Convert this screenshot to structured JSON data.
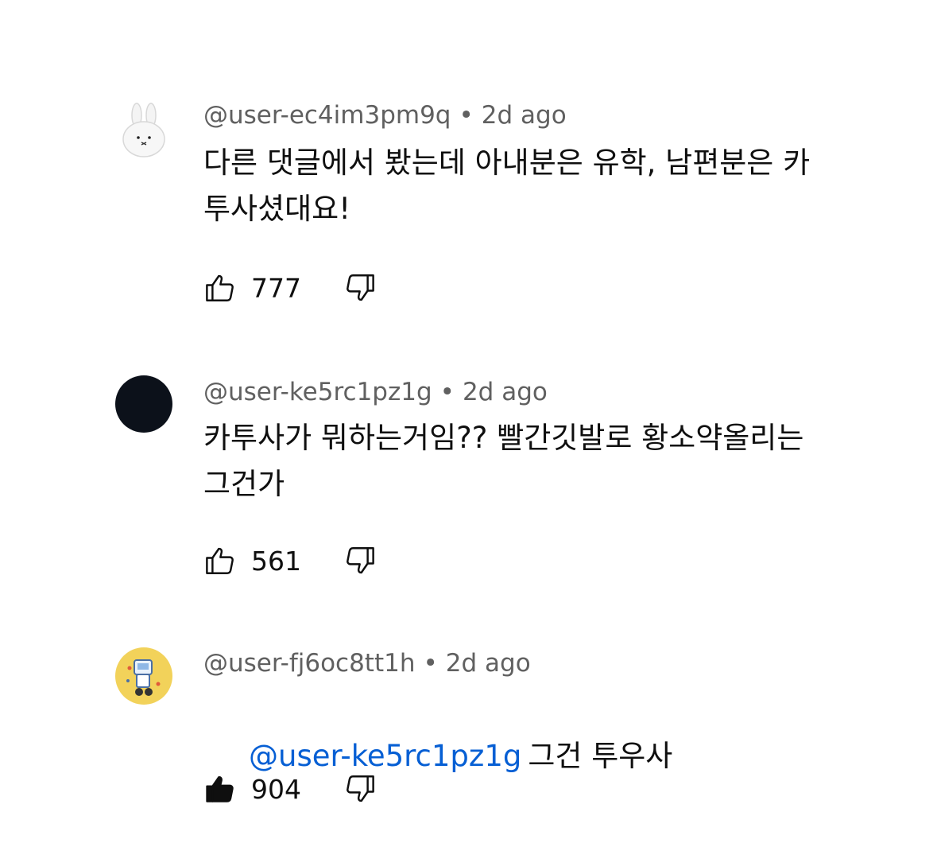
{
  "comments": [
    {
      "username": "@user-ec4im3pm9q",
      "separator": "•",
      "time": "2d ago",
      "text": "다른 댓글에서 봤는데 아내분은 유학, 남편분은 카\n투사셨대요!",
      "likes": "777",
      "liked": false,
      "avatar_icon": "bunny-plush-avatar-icon"
    },
    {
      "username": "@user-ke5rc1pz1g",
      "separator": "•",
      "time": "2d ago",
      "text": "카투사가 뭐하는거임?? 빨간깃발로 황소약올리는\n그건가",
      "likes": "561",
      "liked": false,
      "avatar_icon": "black-circle-avatar-icon"
    },
    {
      "username": "@user-fj6oc8tt1h",
      "separator": "•",
      "time": "2d ago",
      "mention": "@user-ke5rc1pz1g",
      "text": "그건 투우사",
      "likes": "904",
      "liked": true,
      "avatar_icon": "robot-character-avatar-icon"
    }
  ],
  "colors": {
    "meta": "#606060",
    "text": "#0f0f0f",
    "mention": "#065fd4",
    "avatar_dark": "#0c111a",
    "avatar_yellow": "#f2d25a"
  }
}
